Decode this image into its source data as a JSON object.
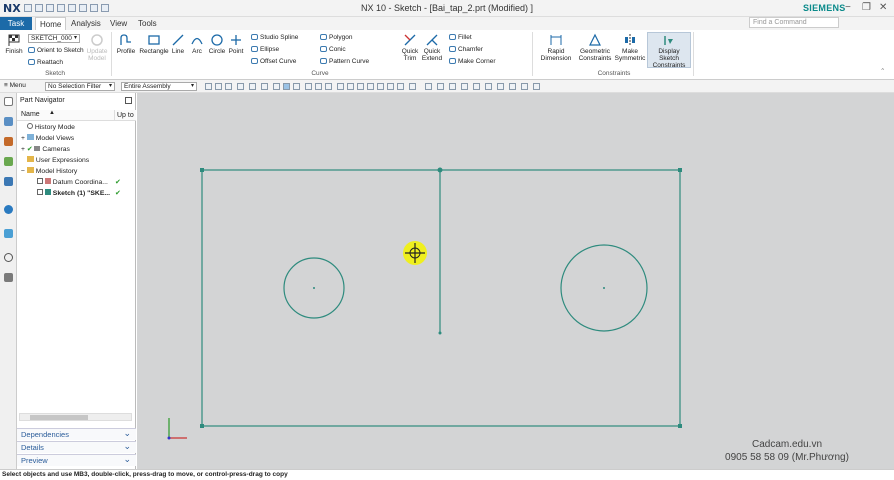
{
  "app": {
    "logo": "NX",
    "title": "NX 10 - Sketch - [Bai_tap_2.prt (Modified) ]",
    "brand": "SIEMENS"
  },
  "window_controls": {
    "minimize": "−",
    "restore": "❐",
    "close": "✕"
  },
  "tabs": {
    "task": "Task",
    "items": [
      "Home",
      "Analysis",
      "View",
      "Tools"
    ]
  },
  "find_command": {
    "placeholder": "Find a Command"
  },
  "ribbon": {
    "sketch_group": {
      "sketch_name": "SKETCH_000",
      "finish": "Finish",
      "orient": "Orient to Sketch",
      "reattach": "Reattach",
      "update": "Update",
      "update2": "Model",
      "label": "Sketch"
    },
    "curve_group": {
      "profile": "Profile",
      "rectangle": "Rectangle",
      "line": "Line",
      "arc": "Arc",
      "circle": "Circle",
      "point": "Point",
      "studio_spline": "Studio Spline",
      "ellipse": "Ellipse",
      "offset_curve": "Offset Curve",
      "polygon": "Polygon",
      "conic": "Conic",
      "pattern_curve": "Pattern Curve",
      "quick_trim": [
        "Quick",
        "Trim"
      ],
      "quick_extend": [
        "Quick",
        "Extend"
      ],
      "fillet": "Fillet",
      "chamfer": "Chamfer",
      "make_corner": "Make Corner",
      "label": "Curve"
    },
    "constraints_group": {
      "rapid": [
        "Rapid",
        "Dimension"
      ],
      "geometric": [
        "Geometric",
        "Constraints"
      ],
      "symmetric": [
        "Make",
        "Symmetric"
      ],
      "display": [
        "Display Sketch",
        "Constraints"
      ],
      "label": "Constraints"
    }
  },
  "filterbar": {
    "menu": "Menu",
    "selection_filter": "No Selection Filter",
    "scope": "Entire Assembly"
  },
  "navigator": {
    "title": "Part Navigator",
    "columns": {
      "name": "Name",
      "upto": "Up to"
    },
    "rows": [
      {
        "label": "History Mode"
      },
      {
        "label": "Model Views"
      },
      {
        "label": "Cameras"
      },
      {
        "label": "User Expressions"
      },
      {
        "label": "Model History"
      },
      {
        "label": "Datum Coordina..."
      },
      {
        "label": "Sketch (1) \"SKE..."
      }
    ],
    "panels": [
      "Dependencies",
      "Details",
      "Preview"
    ]
  },
  "status": {
    "text": "Select objects and use MB3, double-click, press-drag to move, or control-press-drag to copy"
  },
  "watermark": {
    "line1": "Cadcam.edu.vn",
    "line2": "0905 58 58 09 (Mr.Phương)"
  },
  "colors": {
    "accent": "#1c6aa8",
    "sketch": "#2e8b7e",
    "canvas": "#d3d4d5",
    "cursor": "#f2f20a",
    "brand": "#0a8a8a"
  }
}
